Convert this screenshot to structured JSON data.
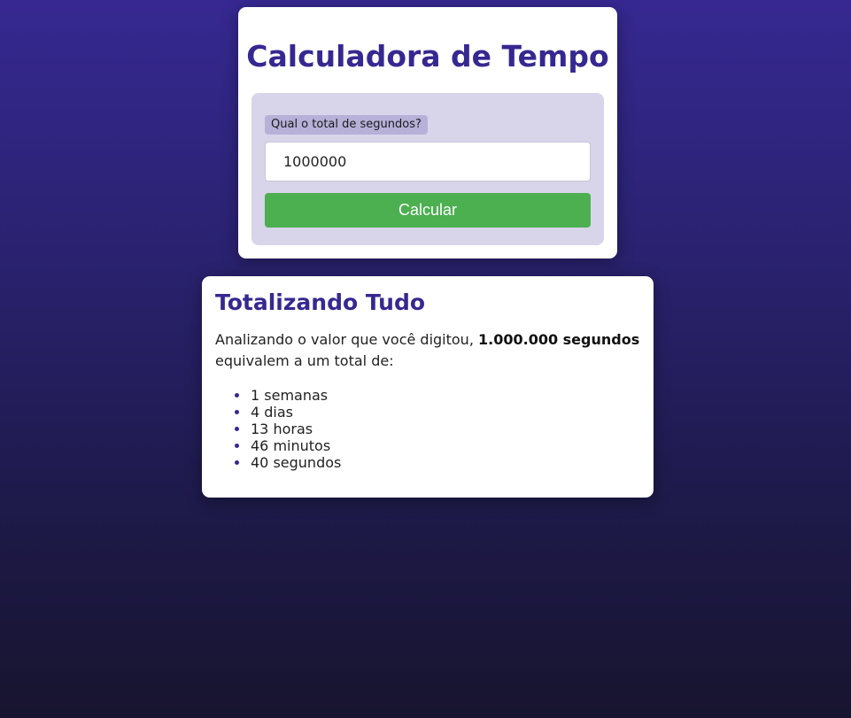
{
  "calculator": {
    "title": "Calculadora de Tempo",
    "input_label": "Qual o total de segundos?",
    "input_value": "1000000",
    "button_label": "Calcular"
  },
  "result": {
    "title": "Totalizando Tudo",
    "intro": "Analizando o valor que você digitou, ",
    "highlight": "1.000.000 segundos",
    "outro": " equivalem a um total de:",
    "items": [
      "1 semanas",
      "4 dias",
      "13 horas",
      "46 minutos",
      "40 segundos"
    ]
  },
  "colors": {
    "accent": "#362891",
    "button": "#4caf50",
    "form_background": "#d8d4ea"
  }
}
